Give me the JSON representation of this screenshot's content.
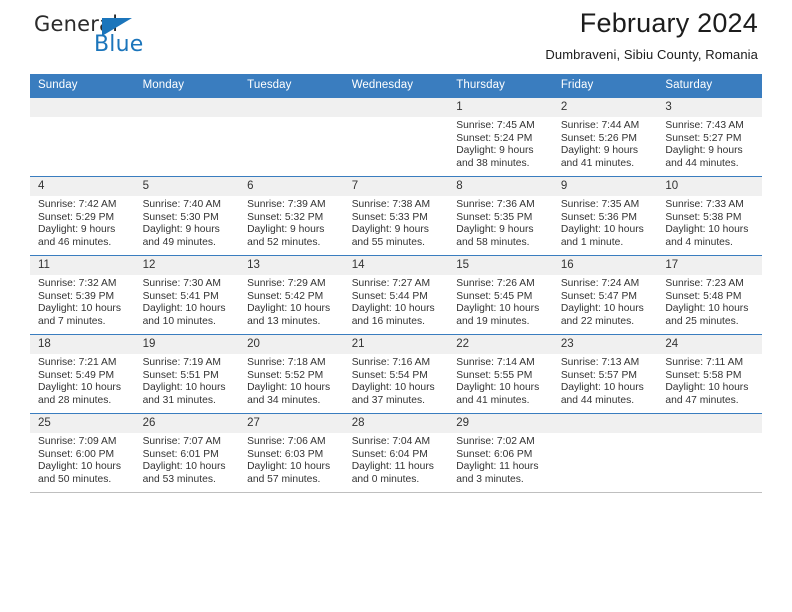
{
  "logo": {
    "word_top": "General",
    "word_bottom": "Blue",
    "triangle_color": "#1b75bb",
    "text_color": "#2b2b2b"
  },
  "header": {
    "title": "February 2024",
    "subtitle": "Dumbraveni, Sibiu County, Romania"
  },
  "theme": {
    "header_bar": "#3a7dbf",
    "daynum_band": "#f0f0f0",
    "text": "#333333"
  },
  "weekdays": [
    "Sunday",
    "Monday",
    "Tuesday",
    "Wednesday",
    "Thursday",
    "Friday",
    "Saturday"
  ],
  "weeks": [
    [
      {
        "day": "",
        "sunrise": "",
        "sunset": "",
        "daylight_1": "",
        "daylight_2": ""
      },
      {
        "day": "",
        "sunrise": "",
        "sunset": "",
        "daylight_1": "",
        "daylight_2": ""
      },
      {
        "day": "",
        "sunrise": "",
        "sunset": "",
        "daylight_1": "",
        "daylight_2": ""
      },
      {
        "day": "",
        "sunrise": "",
        "sunset": "",
        "daylight_1": "",
        "daylight_2": ""
      },
      {
        "day": "1",
        "sunrise": "Sunrise: 7:45 AM",
        "sunset": "Sunset: 5:24 PM",
        "daylight_1": "Daylight: 9 hours",
        "daylight_2": "and 38 minutes."
      },
      {
        "day": "2",
        "sunrise": "Sunrise: 7:44 AM",
        "sunset": "Sunset: 5:26 PM",
        "daylight_1": "Daylight: 9 hours",
        "daylight_2": "and 41 minutes."
      },
      {
        "day": "3",
        "sunrise": "Sunrise: 7:43 AM",
        "sunset": "Sunset: 5:27 PM",
        "daylight_1": "Daylight: 9 hours",
        "daylight_2": "and 44 minutes."
      }
    ],
    [
      {
        "day": "4",
        "sunrise": "Sunrise: 7:42 AM",
        "sunset": "Sunset: 5:29 PM",
        "daylight_1": "Daylight: 9 hours",
        "daylight_2": "and 46 minutes."
      },
      {
        "day": "5",
        "sunrise": "Sunrise: 7:40 AM",
        "sunset": "Sunset: 5:30 PM",
        "daylight_1": "Daylight: 9 hours",
        "daylight_2": "and 49 minutes."
      },
      {
        "day": "6",
        "sunrise": "Sunrise: 7:39 AM",
        "sunset": "Sunset: 5:32 PM",
        "daylight_1": "Daylight: 9 hours",
        "daylight_2": "and 52 minutes."
      },
      {
        "day": "7",
        "sunrise": "Sunrise: 7:38 AM",
        "sunset": "Sunset: 5:33 PM",
        "daylight_1": "Daylight: 9 hours",
        "daylight_2": "and 55 minutes."
      },
      {
        "day": "8",
        "sunrise": "Sunrise: 7:36 AM",
        "sunset": "Sunset: 5:35 PM",
        "daylight_1": "Daylight: 9 hours",
        "daylight_2": "and 58 minutes."
      },
      {
        "day": "9",
        "sunrise": "Sunrise: 7:35 AM",
        "sunset": "Sunset: 5:36 PM",
        "daylight_1": "Daylight: 10 hours",
        "daylight_2": "and 1 minute."
      },
      {
        "day": "10",
        "sunrise": "Sunrise: 7:33 AM",
        "sunset": "Sunset: 5:38 PM",
        "daylight_1": "Daylight: 10 hours",
        "daylight_2": "and 4 minutes."
      }
    ],
    [
      {
        "day": "11",
        "sunrise": "Sunrise: 7:32 AM",
        "sunset": "Sunset: 5:39 PM",
        "daylight_1": "Daylight: 10 hours",
        "daylight_2": "and 7 minutes."
      },
      {
        "day": "12",
        "sunrise": "Sunrise: 7:30 AM",
        "sunset": "Sunset: 5:41 PM",
        "daylight_1": "Daylight: 10 hours",
        "daylight_2": "and 10 minutes."
      },
      {
        "day": "13",
        "sunrise": "Sunrise: 7:29 AM",
        "sunset": "Sunset: 5:42 PM",
        "daylight_1": "Daylight: 10 hours",
        "daylight_2": "and 13 minutes."
      },
      {
        "day": "14",
        "sunrise": "Sunrise: 7:27 AM",
        "sunset": "Sunset: 5:44 PM",
        "daylight_1": "Daylight: 10 hours",
        "daylight_2": "and 16 minutes."
      },
      {
        "day": "15",
        "sunrise": "Sunrise: 7:26 AM",
        "sunset": "Sunset: 5:45 PM",
        "daylight_1": "Daylight: 10 hours",
        "daylight_2": "and 19 minutes."
      },
      {
        "day": "16",
        "sunrise": "Sunrise: 7:24 AM",
        "sunset": "Sunset: 5:47 PM",
        "daylight_1": "Daylight: 10 hours",
        "daylight_2": "and 22 minutes."
      },
      {
        "day": "17",
        "sunrise": "Sunrise: 7:23 AM",
        "sunset": "Sunset: 5:48 PM",
        "daylight_1": "Daylight: 10 hours",
        "daylight_2": "and 25 minutes."
      }
    ],
    [
      {
        "day": "18",
        "sunrise": "Sunrise: 7:21 AM",
        "sunset": "Sunset: 5:49 PM",
        "daylight_1": "Daylight: 10 hours",
        "daylight_2": "and 28 minutes."
      },
      {
        "day": "19",
        "sunrise": "Sunrise: 7:19 AM",
        "sunset": "Sunset: 5:51 PM",
        "daylight_1": "Daylight: 10 hours",
        "daylight_2": "and 31 minutes."
      },
      {
        "day": "20",
        "sunrise": "Sunrise: 7:18 AM",
        "sunset": "Sunset: 5:52 PM",
        "daylight_1": "Daylight: 10 hours",
        "daylight_2": "and 34 minutes."
      },
      {
        "day": "21",
        "sunrise": "Sunrise: 7:16 AM",
        "sunset": "Sunset: 5:54 PM",
        "daylight_1": "Daylight: 10 hours",
        "daylight_2": "and 37 minutes."
      },
      {
        "day": "22",
        "sunrise": "Sunrise: 7:14 AM",
        "sunset": "Sunset: 5:55 PM",
        "daylight_1": "Daylight: 10 hours",
        "daylight_2": "and 41 minutes."
      },
      {
        "day": "23",
        "sunrise": "Sunrise: 7:13 AM",
        "sunset": "Sunset: 5:57 PM",
        "daylight_1": "Daylight: 10 hours",
        "daylight_2": "and 44 minutes."
      },
      {
        "day": "24",
        "sunrise": "Sunrise: 7:11 AM",
        "sunset": "Sunset: 5:58 PM",
        "daylight_1": "Daylight: 10 hours",
        "daylight_2": "and 47 minutes."
      }
    ],
    [
      {
        "day": "25",
        "sunrise": "Sunrise: 7:09 AM",
        "sunset": "Sunset: 6:00 PM",
        "daylight_1": "Daylight: 10 hours",
        "daylight_2": "and 50 minutes."
      },
      {
        "day": "26",
        "sunrise": "Sunrise: 7:07 AM",
        "sunset": "Sunset: 6:01 PM",
        "daylight_1": "Daylight: 10 hours",
        "daylight_2": "and 53 minutes."
      },
      {
        "day": "27",
        "sunrise": "Sunrise: 7:06 AM",
        "sunset": "Sunset: 6:03 PM",
        "daylight_1": "Daylight: 10 hours",
        "daylight_2": "and 57 minutes."
      },
      {
        "day": "28",
        "sunrise": "Sunrise: 7:04 AM",
        "sunset": "Sunset: 6:04 PM",
        "daylight_1": "Daylight: 11 hours",
        "daylight_2": "and 0 minutes."
      },
      {
        "day": "29",
        "sunrise": "Sunrise: 7:02 AM",
        "sunset": "Sunset: 6:06 PM",
        "daylight_1": "Daylight: 11 hours",
        "daylight_2": "and 3 minutes."
      },
      {
        "day": "",
        "sunrise": "",
        "sunset": "",
        "daylight_1": "",
        "daylight_2": ""
      },
      {
        "day": "",
        "sunrise": "",
        "sunset": "",
        "daylight_1": "",
        "daylight_2": ""
      }
    ]
  ]
}
